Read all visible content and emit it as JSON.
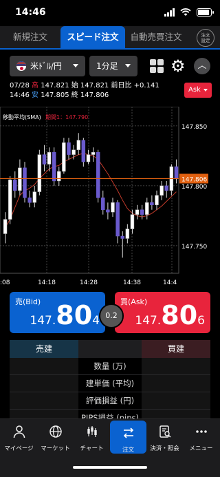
{
  "status": {
    "time": "14:46"
  },
  "tabs": [
    {
      "label": "新規注文",
      "active": false
    },
    {
      "label": "スピード注文",
      "active": true
    },
    {
      "label": "自動売買注文",
      "active": false
    }
  ],
  "order_settings": {
    "line1": "注文",
    "line2": "設定"
  },
  "controls": {
    "pair": "米ﾄﾞﾙ/円",
    "timeframe": "1分足"
  },
  "quote": {
    "date": "07/28",
    "high_label": "高",
    "high": "147.821",
    "open_label": "始",
    "open": "147.821",
    "change_label": "前日比",
    "change": "+0.141",
    "time": "14:46",
    "low_label": "安",
    "low": "147.805",
    "close_label": "終",
    "close": "147.806"
  },
  "ask_select": "Ask",
  "chart_data": {
    "type": "candlestick",
    "indicator_label": "移動平均(SMA)",
    "indicator_period": "期間1：147.790",
    "current_price_label": "147.806",
    "y_ticks": [
      "147.850",
      "147.800",
      "147.750"
    ],
    "x_ticks": [
      ":08",
      "14:18",
      "14:28",
      "14:38",
      "14:4"
    ],
    "ylim": [
      147.727,
      147.866
    ],
    "current_price": 147.806,
    "candles": [
      {
        "o": 147.76,
        "h": 147.778,
        "l": 147.752,
        "c": 147.772
      },
      {
        "o": 147.772,
        "h": 147.808,
        "l": 147.768,
        "c": 147.805
      },
      {
        "o": 147.805,
        "h": 147.812,
        "l": 147.79,
        "c": 147.796
      },
      {
        "o": 147.796,
        "h": 147.822,
        "l": 147.792,
        "c": 147.815
      },
      {
        "o": 147.815,
        "h": 147.82,
        "l": 147.786,
        "c": 147.79
      },
      {
        "o": 147.79,
        "h": 147.796,
        "l": 147.782,
        "c": 147.786
      },
      {
        "o": 147.786,
        "h": 147.8,
        "l": 147.782,
        "c": 147.795
      },
      {
        "o": 147.795,
        "h": 147.83,
        "l": 147.792,
        "c": 147.826
      },
      {
        "o": 147.826,
        "h": 147.834,
        "l": 147.812,
        "c": 147.818
      },
      {
        "o": 147.818,
        "h": 147.832,
        "l": 147.812,
        "c": 147.828
      },
      {
        "o": 147.828,
        "h": 147.832,
        "l": 147.8,
        "c": 147.804
      },
      {
        "o": 147.804,
        "h": 147.816,
        "l": 147.8,
        "c": 147.812
      },
      {
        "o": 147.812,
        "h": 147.84,
        "l": 147.81,
        "c": 147.836
      },
      {
        "o": 147.836,
        "h": 147.84,
        "l": 147.822,
        "c": 147.826
      },
      {
        "o": 147.826,
        "h": 147.834,
        "l": 147.822,
        "c": 147.83
      },
      {
        "o": 147.83,
        "h": 147.844,
        "l": 147.826,
        "c": 147.838
      },
      {
        "o": 147.838,
        "h": 147.84,
        "l": 147.816,
        "c": 147.82
      },
      {
        "o": 147.82,
        "h": 147.83,
        "l": 147.818,
        "c": 147.826
      },
      {
        "o": 147.826,
        "h": 147.832,
        "l": 147.82,
        "c": 147.828
      },
      {
        "o": 147.828,
        "h": 147.83,
        "l": 147.786,
        "c": 147.79
      },
      {
        "o": 147.79,
        "h": 147.796,
        "l": 147.776,
        "c": 147.78
      },
      {
        "o": 147.78,
        "h": 147.786,
        "l": 147.772,
        "c": 147.778
      },
      {
        "o": 147.778,
        "h": 147.79,
        "l": 147.774,
        "c": 147.786
      },
      {
        "o": 147.786,
        "h": 147.788,
        "l": 147.752,
        "c": 147.758
      },
      {
        "o": 147.758,
        "h": 147.762,
        "l": 147.74,
        "c": 147.756
      },
      {
        "o": 147.756,
        "h": 147.768,
        "l": 147.752,
        "c": 147.764
      },
      {
        "o": 147.764,
        "h": 147.78,
        "l": 147.76,
        "c": 147.776
      },
      {
        "o": 147.776,
        "h": 147.784,
        "l": 147.772,
        "c": 147.78
      },
      {
        "o": 147.78,
        "h": 147.784,
        "l": 147.772,
        "c": 147.776
      },
      {
        "o": 147.776,
        "h": 147.79,
        "l": 147.772,
        "c": 147.786
      },
      {
        "o": 147.786,
        "h": 147.792,
        "l": 147.78,
        "c": 147.784
      },
      {
        "o": 147.784,
        "h": 147.796,
        "l": 147.78,
        "c": 147.792
      },
      {
        "o": 147.792,
        "h": 147.804,
        "l": 147.788,
        "c": 147.8
      },
      {
        "o": 147.8,
        "h": 147.804,
        "l": 147.79,
        "c": 147.796
      },
      {
        "o": 147.796,
        "h": 147.818,
        "l": 147.792,
        "c": 147.816
      },
      {
        "o": 147.816,
        "h": 147.822,
        "l": 147.802,
        "c": 147.806
      }
    ],
    "sma": [
      147.765,
      147.772,
      147.782,
      147.792,
      147.796,
      147.798,
      147.801,
      147.806,
      147.81,
      147.814,
      147.816,
      147.817,
      147.82,
      147.822,
      147.824,
      147.826,
      147.827,
      147.826,
      147.825,
      147.822,
      147.816,
      147.81,
      147.803,
      147.796,
      147.788,
      147.781,
      147.777,
      147.775,
      147.774,
      147.775,
      147.777,
      147.78,
      147.783,
      147.787,
      147.791,
      147.795
    ]
  },
  "bid": {
    "label": "売(Bid)",
    "price_prefix": "147.",
    "price_big": "80",
    "price_tail": "4"
  },
  "ask": {
    "label": "買(Ask)",
    "price_prefix": "147.",
    "price_big": "80",
    "price_tail": "6"
  },
  "spread": "0.2",
  "position_table": {
    "sell_header": "売建",
    "buy_header": "買建",
    "rows": [
      "数量 (万)",
      "建単価 (平均)",
      "評価損益 (円)",
      "PIPS損益 (pips)"
    ]
  },
  "nav": [
    {
      "label": "マイページ",
      "active": false
    },
    {
      "label": "マーケット",
      "active": false
    },
    {
      "label": "チャート",
      "active": false
    },
    {
      "label": "注文",
      "active": true
    },
    {
      "label": "決済・照会",
      "active": false
    },
    {
      "label": "メニュー",
      "active": false
    }
  ],
  "colors": {
    "bid": "#0a62d0",
    "ask": "#e8243c",
    "up_candle": "#ffffff",
    "down_candle": "#6a5acd",
    "sma_line": "#c23a2a",
    "price_line": "#e06010"
  }
}
